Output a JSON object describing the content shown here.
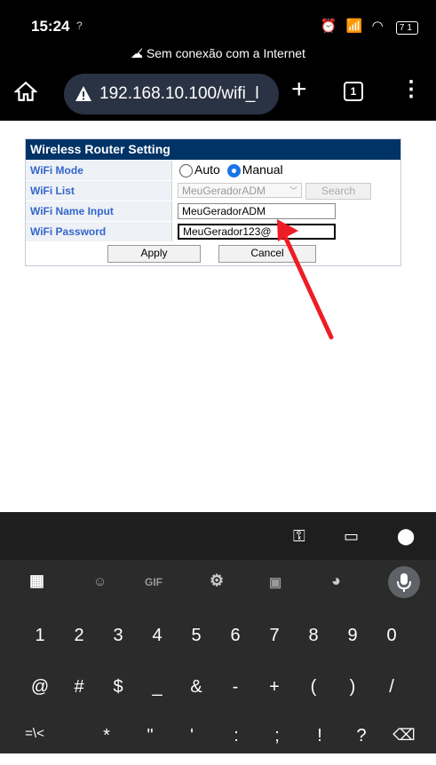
{
  "status_bar": {
    "time": "15:24",
    "time_indicator": "?",
    "battery": "71",
    "no_connection": "Sem conexão com a Internet"
  },
  "browser": {
    "url": "192.168.10.100/wifi_l",
    "tab_count": "1"
  },
  "router": {
    "title": "Wireless Router Setting",
    "wifi_mode_label": "WiFi Mode",
    "mode_auto": "Auto",
    "mode_manual": "Manual",
    "mode_selected": "Manual",
    "wifi_list_label": "WiFi List",
    "wifi_list_selected": "MeuGeradorADM",
    "search_label": "Search",
    "wifi_name_label": "WiFi Name Input",
    "wifi_name_value": "MeuGeradorADM",
    "wifi_password_label": "WiFi Password",
    "wifi_password_value": "MeuGerador123@",
    "apply_label": "Apply",
    "cancel_label": "Cancel"
  },
  "keyboard": {
    "tools": [
      "GIF"
    ],
    "number_row": [
      "1",
      "2",
      "3",
      "4",
      "5",
      "6",
      "7",
      "8",
      "9",
      "0"
    ],
    "symbol_row1": [
      "@",
      "#",
      "$",
      "_",
      "&",
      "-",
      "+",
      "(",
      ")",
      "/"
    ],
    "symbol_row2": [
      "=\\<",
      "*",
      "\"",
      "'",
      ":",
      ";",
      "!",
      "?"
    ]
  },
  "colors": {
    "accent": "#1a73e8",
    "panel_header": "#003366",
    "label_text": "#3366cc",
    "annotation_arrow": "#ee1c25"
  }
}
